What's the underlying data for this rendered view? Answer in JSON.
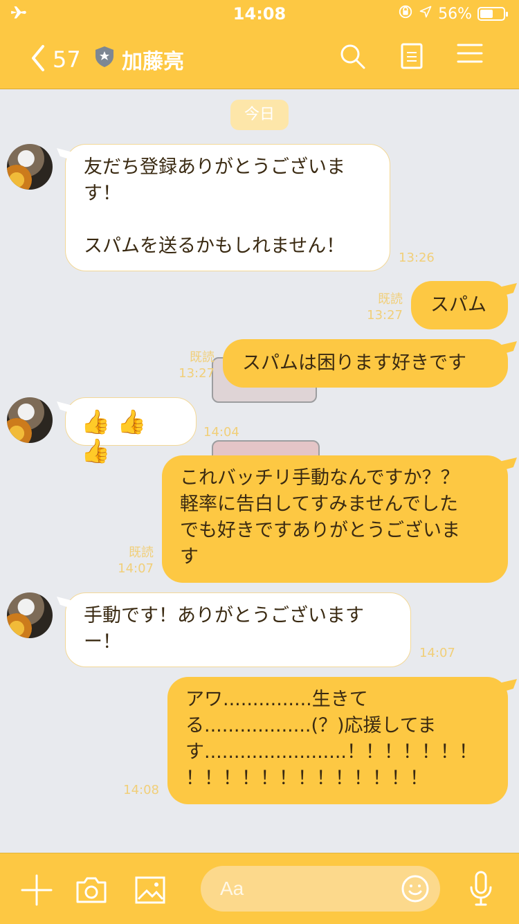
{
  "status": {
    "time": "14:08",
    "battery": "56%"
  },
  "nav": {
    "back_count": "57",
    "friend_name": "加藤亮"
  },
  "chat": {
    "date_label": "今日"
  },
  "messages": [
    {
      "text_lines": [
        "友だち登録ありがとうございま",
        "す！",
        "",
        "スパムを送るかもしれません！"
      ],
      "time": "13:26"
    },
    {
      "text": "スパム",
      "read": "既読",
      "time": "13:27"
    },
    {
      "text": "スパムは困ります好きです",
      "read": "既読",
      "time": "13:27"
    },
    {
      "text": "👍👍👍",
      "time": "14:04"
    },
    {
      "text_lines": [
        "これバッチリ手動なんですか？？",
        "軽率に告白してすみませんでした",
        "でも好きですありがとうございま",
        "す"
      ],
      "read": "既読",
      "time": "14:07"
    },
    {
      "text_lines": [
        "手動です！ありがとうございます",
        "ー！"
      ],
      "time": "14:07"
    },
    {
      "text_lines": [
        "アワ...............生きて",
        "る..................(？)応援してま",
        "す........................！！！！！！！",
        "！！！！！！！！！！！！！"
      ],
      "time": "14:08"
    }
  ],
  "footer": {
    "input_placeholder": "Aa"
  },
  "colors": {
    "header": "#fdc843",
    "bubble_out": "#fdc843",
    "bubble_in": "#ffffff",
    "background": "#e8eaee"
  }
}
